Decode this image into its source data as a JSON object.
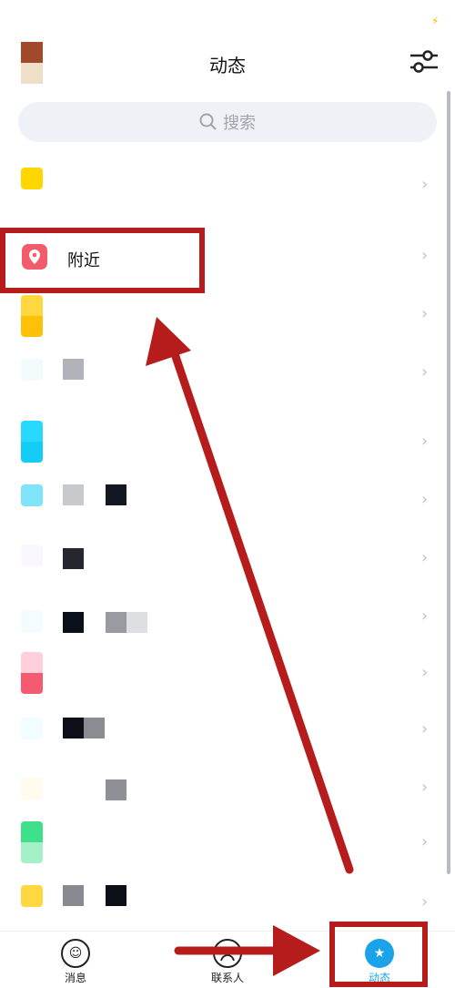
{
  "header": {
    "title": "动态",
    "status_icon": "lightning-icon",
    "filter_icon": "sliders-icon"
  },
  "search": {
    "placeholder": "搜索",
    "icon": "search-icon"
  },
  "list": {
    "items": [
      {
        "label": "",
        "icon_color": "#ffd600"
      },
      {
        "label": "附近",
        "icon_color": "#f25c6a",
        "icon": "location-pin-icon"
      },
      {
        "label": "",
        "icon_color": "#ffc107"
      },
      {
        "label": "",
        "icon_color": "#f3fbfd"
      },
      {
        "label": "",
        "icon_color": "#1ed2ff"
      },
      {
        "label": "",
        "icon_color": "#7fe3fa"
      },
      {
        "label": "",
        "icon_color": "#fbf7ff"
      },
      {
        "label": "",
        "icon_color": "#f5fcff"
      },
      {
        "label": "",
        "icon_color": "#f66a7e"
      },
      {
        "label": "",
        "icon_color": "#f2fdff"
      },
      {
        "label": "",
        "icon_color": "#fffcef"
      },
      {
        "label": "",
        "icon_color": "#3ee08a"
      },
      {
        "label": "",
        "icon_color": "#ffd740"
      }
    ],
    "chevron": "›"
  },
  "tabbar": {
    "tabs": [
      {
        "label": "消息",
        "icon": "message-smiley-icon",
        "active": false
      },
      {
        "label": "联系人",
        "icon": "contacts-person-icon",
        "active": false
      },
      {
        "label": "动态",
        "icon": "star-dynamic-icon",
        "active": true
      }
    ]
  },
  "colors": {
    "accent": "#1aa3e8",
    "annotation": "#b71c1c"
  }
}
